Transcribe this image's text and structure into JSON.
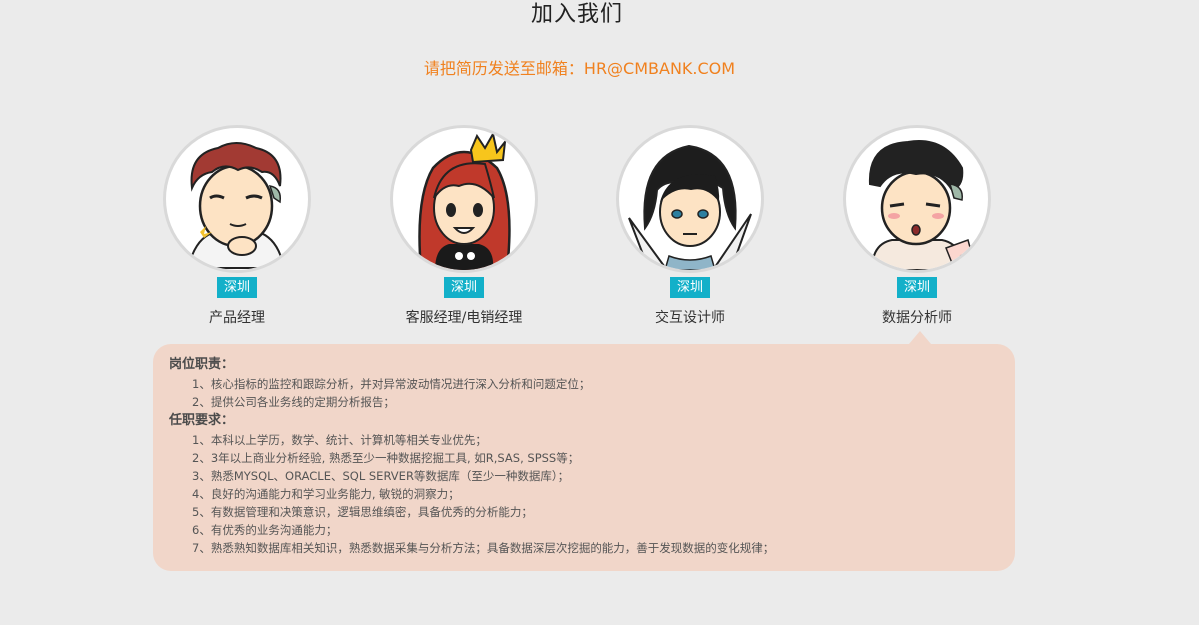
{
  "header": {
    "title": "加入我们",
    "email_text": "请把简历发送至邮箱：HR@CMBANK.COM"
  },
  "positions": [
    {
      "city": "深圳",
      "title": "产品经理"
    },
    {
      "city": "深圳",
      "title": "客服经理/电销经理"
    },
    {
      "city": "深圳",
      "title": "交互设计师"
    },
    {
      "city": "深圳",
      "title": "数据分析师"
    }
  ],
  "detail": {
    "duty_title": "岗位职责：",
    "duties": [
      "1、核心指标的监控和跟踪分析，并对异常波动情况进行深入分析和问题定位；",
      "2、提供公司各业务线的定期分析报告；"
    ],
    "req_title": "任职要求：",
    "requirements": [
      "1、本科以上学历，数学、统计、计算机等相关专业优先；",
      "2、3年以上商业分析经验, 熟悉至少一种数据挖掘工具, 如R,SAS, SPSS等；",
      "3、熟悉MYSQL、ORACLE、SQL SERVER等数据库（至少一种数据库）；",
      "4、良好的沟通能力和学习业务能力, 敏锐的洞察力；",
      "5、有数据管理和决策意识，逻辑思维缜密，具备优秀的分析能力；",
      "6、有优秀的业务沟通能力；",
      "7、熟悉熟知数据库相关知识，熟悉数据采集与分析方法；具备数据深层次挖掘的能力，善于发现数据的变化规律；"
    ]
  },
  "colors": {
    "accent_orange": "#f0811f",
    "city_badge": "#13b0c9",
    "popup_bg": "#f1d6c9",
    "page_bg": "#ebebeb"
  }
}
